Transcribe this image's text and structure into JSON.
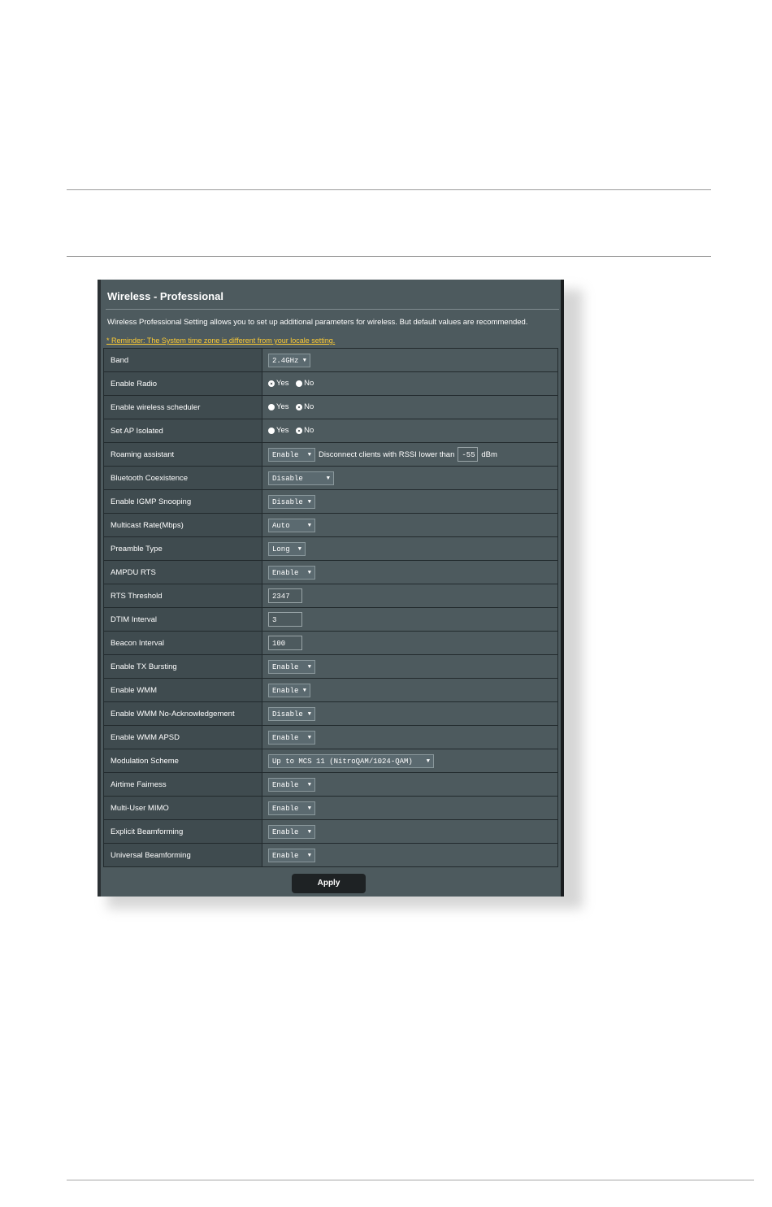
{
  "panel": {
    "title": "Wireless - Professional",
    "description": "Wireless Professional Setting allows you to set up additional parameters for wireless. But default values are recommended.",
    "reminder": "* Reminder: The System time zone is different from your locale setting."
  },
  "rows": {
    "band": {
      "label": "Band",
      "value": "2.4GHz"
    },
    "enable_radio": {
      "label": "Enable Radio",
      "yes": "Yes",
      "no": "No",
      "selected": "Yes"
    },
    "wireless_scheduler": {
      "label": "Enable wireless scheduler",
      "yes": "Yes",
      "no": "No",
      "selected": "No"
    },
    "ap_isolated": {
      "label": "Set AP Isolated",
      "yes": "Yes",
      "no": "No",
      "selected": "No"
    },
    "roaming": {
      "label": "Roaming assistant",
      "value": "Enable",
      "text": "Disconnect clients with RSSI lower than",
      "rssi": "-55",
      "unit": "dBm"
    },
    "bt_coexistence": {
      "label": "Bluetooth Coexistence",
      "value": "Disable"
    },
    "igmp": {
      "label": "Enable IGMP Snooping",
      "value": "Disable"
    },
    "multicast": {
      "label": "Multicast Rate(Mbps)",
      "value": "Auto"
    },
    "preamble": {
      "label": "Preamble Type",
      "value": "Long"
    },
    "ampdu_rts": {
      "label": "AMPDU RTS",
      "value": "Enable"
    },
    "rts_threshold": {
      "label": "RTS Threshold",
      "value": "2347"
    },
    "dtim": {
      "label": "DTIM Interval",
      "value": "3"
    },
    "beacon": {
      "label": "Beacon Interval",
      "value": "100"
    },
    "tx_bursting": {
      "label": "Enable TX Bursting",
      "value": "Enable"
    },
    "wmm": {
      "label": "Enable WMM",
      "value": "Enable"
    },
    "wmm_noack": {
      "label": "Enable WMM No-Acknowledgement",
      "value": "Disable"
    },
    "wmm_apsd": {
      "label": "Enable WMM APSD",
      "value": "Enable"
    },
    "modulation": {
      "label": "Modulation Scheme",
      "value": "Up to MCS 11 (NitroQAM/1024-QAM)"
    },
    "airtime": {
      "label": "Airtime Fairness",
      "value": "Enable"
    },
    "mu_mimo": {
      "label": "Multi-User MIMO",
      "value": "Enable"
    },
    "explicit_bf": {
      "label": "Explicit Beamforming",
      "value": "Enable"
    },
    "universal_bf": {
      "label": "Universal Beamforming",
      "value": "Enable"
    }
  },
  "apply_label": "Apply",
  "icons": {
    "dropdown": "chevron-down-icon",
    "radio": "radio-icon"
  }
}
